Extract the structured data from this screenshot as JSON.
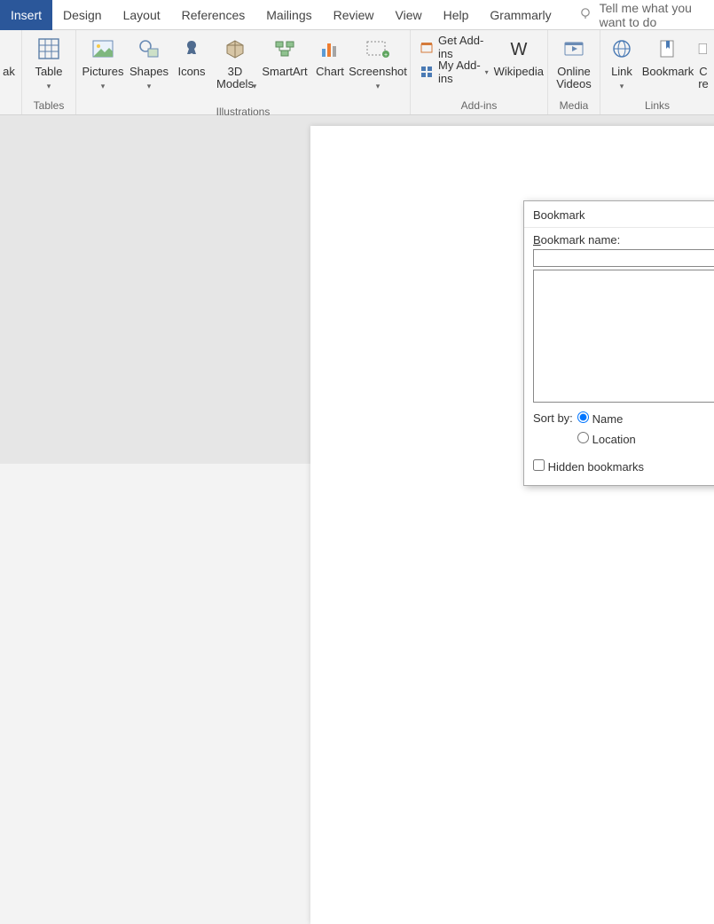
{
  "tabs": {
    "insert": "Insert",
    "design": "Design",
    "layout": "Layout",
    "references": "References",
    "mailings": "Mailings",
    "review": "Review",
    "view": "View",
    "help": "Help",
    "grammarly": "Grammarly"
  },
  "tellme": "Tell me what you want to do",
  "ribbon": {
    "break_partial": "ak",
    "table": "Table",
    "pictures": "Pictures",
    "shapes": "Shapes",
    "icons": "Icons",
    "models": "3D\nModels",
    "smartart": "SmartArt",
    "chart": "Chart",
    "screenshot": "Screenshot",
    "getaddins": "Get Add-ins",
    "myaddins": "My Add-ins",
    "wikipedia": "Wikipedia",
    "onlinevideos": "Online\nVideos",
    "link": "Link",
    "bookmark": "Bookmark",
    "cross_partial": "C\nre",
    "groups": {
      "tables": "Tables",
      "illustrations": "Illustrations",
      "addins": "Add-ins",
      "media": "Media",
      "links": "Links"
    }
  },
  "dialog": {
    "title": "Bookmark",
    "name_label": "Bookmark name:",
    "name_value": "",
    "sort_label": "Sort by:",
    "sort_name": "Name",
    "sort_location": "Location",
    "hidden": "Hidden bookmarks"
  }
}
